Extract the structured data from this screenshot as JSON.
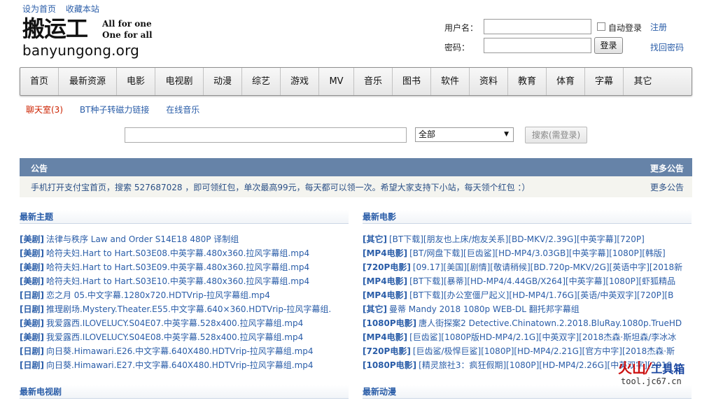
{
  "top_links": [
    "设为首页",
    "收藏本站"
  ],
  "logo": {
    "cn": "搬运工",
    "en1": "All for one",
    "en2": "One for all",
    "domain": "banyungong.org"
  },
  "login": {
    "username_label": "用户名：",
    "password_label": "密码：",
    "auto_login": "自动登录",
    "register": "注册",
    "login_button": "登录",
    "forgot": "找回密码",
    "username_value": "",
    "password_value": ""
  },
  "nav": {
    "items": [
      "首页",
      "最新资源",
      "电影",
      "电视剧",
      "动漫",
      "综艺",
      "游戏",
      "MV",
      "音乐",
      "图书",
      "软件",
      "资料",
      "教育",
      "体育",
      "字幕",
      "其它"
    ]
  },
  "sublinks": [
    {
      "label": "聊天室(3)",
      "color": "#cc2200"
    },
    {
      "label": "BT种子转磁力链接",
      "color": "#2a5da8"
    },
    {
      "label": "在线音乐",
      "color": "#2a5da8"
    }
  ],
  "search": {
    "value": "",
    "scope": "全部",
    "button": "搜索(需登录)"
  },
  "notice": {
    "title": "公告",
    "more": "更多公告",
    "text": "手机打开支付宝首页，搜索 527687028 ，即可领红包，单次最高99元，每天都可以领一次。希望大家支持下小站，每天领个红包 ：）",
    "more2": "更多公告"
  },
  "latest_topics": {
    "title": "最新主题",
    "items": [
      {
        "cat": "[美剧]",
        "title": "法律与秩序 Law and Order S14E18 480P 译制组"
      },
      {
        "cat": "[美剧]",
        "title": "哈符夫妇.Hart to Hart.S03E08.中英字幕.480x360.拉风字幕组.mp4"
      },
      {
        "cat": "[美剧]",
        "title": "哈符夫妇.Hart to Hart.S03E09.中英字幕.480x360.拉风字幕组.mp4"
      },
      {
        "cat": "[美剧]",
        "title": "哈符夫妇.Hart to Hart.S03E10.中英字幕.480x360.拉风字幕组.mp4"
      },
      {
        "cat": "[日剧]",
        "title": "恋之月 05.中文字幕.1280x720.HDTVrip-拉风字幕组.mp4"
      },
      {
        "cat": "[日剧]",
        "title": "推理剧场.Mystery.Theater.E55.中文字幕.640×360.HDTVrip-拉风字幕组."
      },
      {
        "cat": "[美剧]",
        "title": "我爱露西.ILOVELUCY.S04E07.中英字幕.528x400.拉风字幕组.mp4"
      },
      {
        "cat": "[美剧]",
        "title": "我爱露西.ILOVELUCY.S04E08.中英字幕.528x400.拉风字幕组.mp4"
      },
      {
        "cat": "[日剧]",
        "title": "向日葵.Himawari.E26.中文字幕.640X480.HDTVrip-拉风字幕组.mp4"
      },
      {
        "cat": "[日剧]",
        "title": "向日葵.Himawari.E27.中文字幕.640X480.HDTVrip-拉风字幕组.mp4"
      }
    ]
  },
  "latest_movies": {
    "title": "最新电影",
    "items": [
      {
        "cat": "[其它]",
        "title": "[BT下载][朋友也上床/炮友关系][BD-MKV/2.39G][中英字幕][720P]"
      },
      {
        "cat": "[MP4电影]",
        "title": "[BT/网盘下载][巨齿鲨][HD-MP4/3.03GB][中英字幕][1080P][韩版]"
      },
      {
        "cat": "[720P电影]",
        "title": "[09.17][美国][剧情][敬请稍候][BD.720p-MKV/2G][英语中字][2018新"
      },
      {
        "cat": "[MP4电影]",
        "title": "[BT下载][暴蒂][HD-MP4/4.44GB/X264][中英字幕][1080P][虾狐精品"
      },
      {
        "cat": "[MP4电影]",
        "title": "[BT下载][办公室僵尸起义][HD-MP4/1.76G][英语/中英双字][720P][B"
      },
      {
        "cat": "[其它]",
        "title": "曼蒂 Mandy 2018 1080p WEB-DL 翻托邦字幕组"
      },
      {
        "cat": "[1080P电影]",
        "title": "唐人街探案2 Detective.Chinatown.2.2018.BluRay.1080p.TrueHD"
      },
      {
        "cat": "[MP4电影]",
        "title": "[巨齿鲨][1080P版HD-MP4/2.1G][中英双字][2018杰森·斯坦森/李冰冰"
      },
      {
        "cat": "[720P电影]",
        "title": "[巨齿鲨/极悍巨鲨][1080P][HD-MP4/2.21G][官方中字][2018杰森·斯"
      },
      {
        "cat": "[1080P电影]",
        "title": "[精灵旅社3：疯狂假期][1080P][HD-MP4/2.26G][中英双字][2018"
      }
    ]
  },
  "bottom_sections": [
    "最新电视剧",
    "最新动漫"
  ],
  "watermark": {
    "main": "火山",
    "slash": "/",
    "sub": "工具箱",
    "url": "tool.jc67.cn"
  }
}
